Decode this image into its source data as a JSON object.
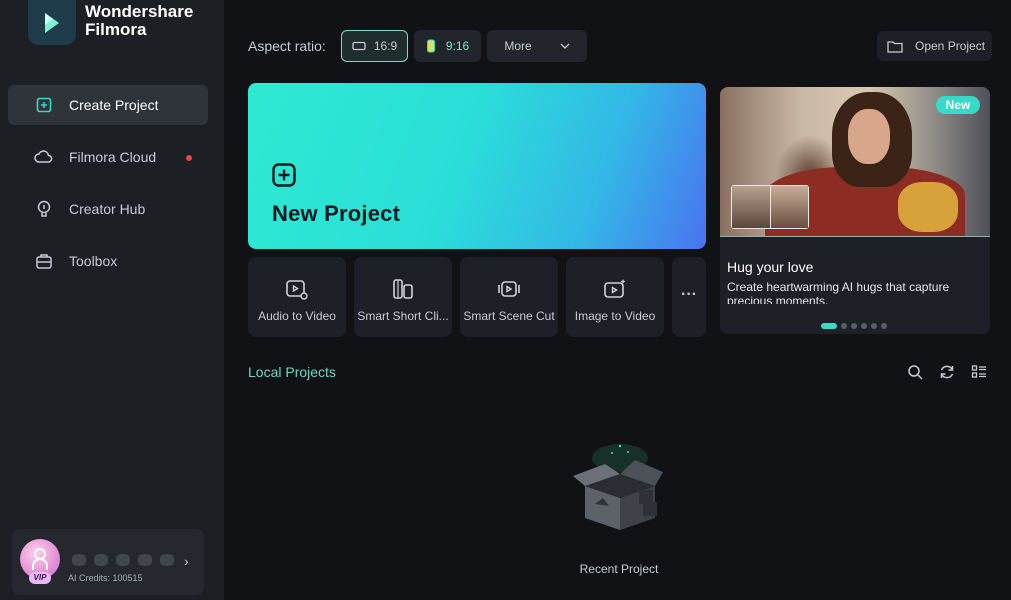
{
  "brand": {
    "line1": "Wondershare",
    "line2": "Filmora"
  },
  "sidebar": {
    "items": [
      {
        "label": "Create Project",
        "icon": "plus-square-icon",
        "active": true
      },
      {
        "label": "Filmora Cloud",
        "icon": "cloud-icon",
        "dot": true
      },
      {
        "label": "Creator Hub",
        "icon": "bulb-icon"
      },
      {
        "label": "Toolbox",
        "icon": "toolbox-icon"
      }
    ],
    "account": {
      "vip": "VIP",
      "credits": "AI Credits: 100515"
    }
  },
  "topbar": {
    "aspect_label": "Aspect ratio:",
    "ratio_16_9": "16:9",
    "ratio_9_16": "9:16",
    "more": "More",
    "open_project": "Open Project"
  },
  "new_project": {
    "label": "New Project"
  },
  "tools": [
    {
      "label": "Audio to Video",
      "icon": "audio-video-icon"
    },
    {
      "label": "Smart Short Cli...",
      "icon": "smart-short-clip-icon"
    },
    {
      "label": "Smart Scene Cut",
      "icon": "scene-cut-icon"
    },
    {
      "label": "Image to Video",
      "icon": "image-video-icon"
    }
  ],
  "tools_more": "···",
  "promo": {
    "badge": "New",
    "title": "Hug your love",
    "description": "Create heartwarming AI hugs that capture precious moments.",
    "pages": 6,
    "current_page": 1
  },
  "local": {
    "title": "Local Projects",
    "empty_label": "Recent Project"
  },
  "colors": {
    "accent": "#38d9c7",
    "bg": "#101216",
    "sidebar": "#1c1f24"
  }
}
